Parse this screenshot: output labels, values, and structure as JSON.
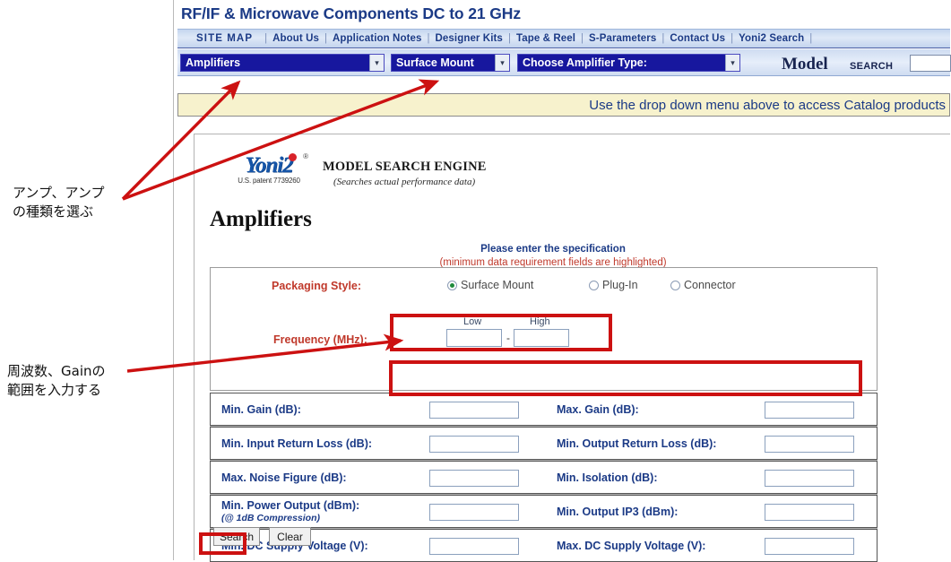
{
  "site": {
    "title": "RF/IF & Microwave Components  DC to 21 GHz"
  },
  "nav": {
    "sitemap": "SITE MAP",
    "items": [
      "About Us",
      "Application Notes",
      "Designer Kits",
      "Tape & Reel",
      "S-Parameters",
      "Contact Us",
      "Yoni2 Search"
    ],
    "separator": "|"
  },
  "selectors": {
    "category": {
      "value": "Amplifiers",
      "arrow": "chevron-down-icon"
    },
    "package": {
      "value": "Surface Mount",
      "arrow": "chevron-down-icon"
    },
    "amp_type": {
      "value": "Choose Amplifier Type:",
      "arrow": "chevron-down-icon"
    },
    "model_label": "Model",
    "search_word": "SEARCH",
    "model_input_value": ""
  },
  "notice": {
    "text": "Use the drop down menu above to access Catalog products"
  },
  "logo": {
    "word": "Yoni",
    "numeral": "2",
    "registered": "®",
    "patent": "U.S. patent 7739260",
    "engine_title": "MODEL SEARCH ENGINE",
    "engine_sub": "(Searches actual performance data)"
  },
  "page": {
    "heading": "Amplifiers",
    "spec_line1": "Please enter the specification",
    "spec_line2": "(minimum data requirement fields are highlighted)"
  },
  "form": {
    "packaging_label": "Packaging Style:",
    "packaging_options": [
      {
        "label": "Surface Mount",
        "selected": true
      },
      {
        "label": "Plug-In",
        "selected": false
      },
      {
        "label": "Connector",
        "selected": false
      }
    ],
    "frequency_label": "Frequency (MHz):",
    "frequency_low_label": "Low",
    "frequency_high_label": "High",
    "frequency_dash": "-",
    "frequency_low_value": "",
    "frequency_high_value": "",
    "rows": [
      {
        "left_label": "Min. Gain (dB):",
        "left_sub": "",
        "left_value": "",
        "right_label": "Max. Gain (dB):",
        "right_value": ""
      },
      {
        "left_label": "Min. Input Return Loss (dB):",
        "left_sub": "",
        "left_value": "",
        "right_label": "Min. Output Return Loss (dB):",
        "right_value": ""
      },
      {
        "left_label": "Max. Noise Figure (dB):",
        "left_sub": "",
        "left_value": "",
        "right_label": "Min. Isolation (dB):",
        "right_value": ""
      },
      {
        "left_label": "Min. Power Output (dBm):",
        "left_sub": "(@ 1dB Compression)",
        "left_value": "",
        "right_label": "Min. Output IP3 (dBm):",
        "right_value": ""
      },
      {
        "left_label": "Min. DC Supply Voltage (V):",
        "left_sub": "",
        "left_value": "",
        "right_label": "Max. DC Supply Voltage (V):",
        "right_value": ""
      }
    ],
    "search_button": "Search",
    "clear_button": "Clear"
  },
  "annotations": {
    "note_amplifier": "アンプ、アンプ\nの種類を選ぶ",
    "note_frequency": "周波数、Gainの\n範囲を入力する",
    "highlight_color": "#cc1111"
  }
}
